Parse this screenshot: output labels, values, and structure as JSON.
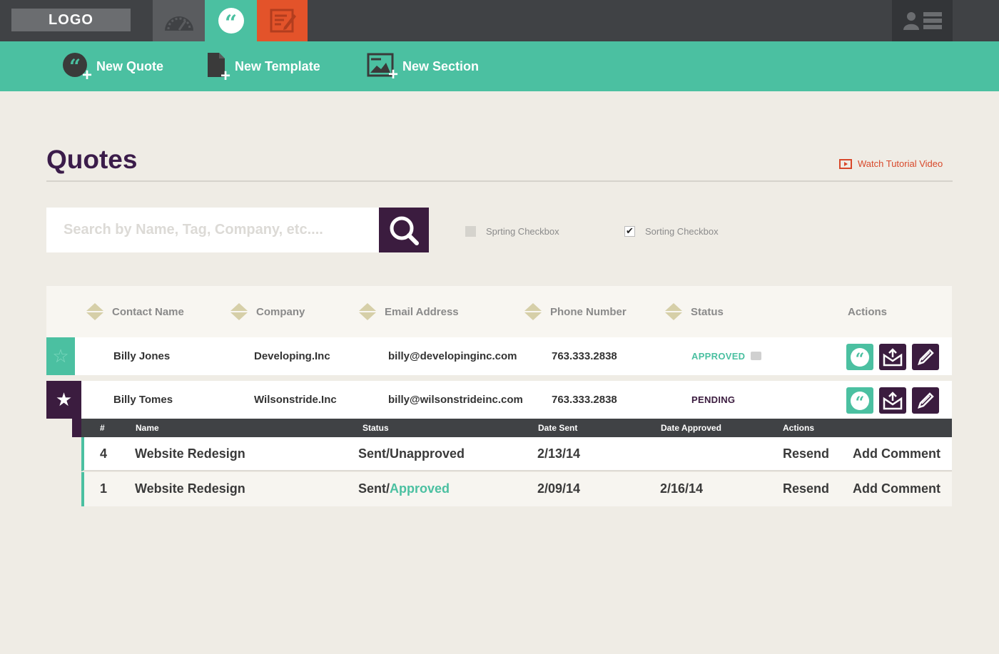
{
  "brand": {
    "logo_text": "LOGO"
  },
  "colors": {
    "teal": "#4bc0a1",
    "purple": "#3b1c3f",
    "orange": "#e3532a",
    "dark": "#404245"
  },
  "nav": {
    "tabs": [
      {
        "icon": "speedometer-icon"
      },
      {
        "icon": "quote-icon",
        "active": true
      },
      {
        "icon": "document-edit-icon"
      }
    ],
    "user_icon": "user-icon",
    "menu_icon": "list-icon"
  },
  "actions": {
    "new_quote": "New Quote",
    "new_template": "New Template",
    "new_section": "New Section"
  },
  "page": {
    "title": "Quotes",
    "tutorial_link": "Watch Tutorial Video"
  },
  "search": {
    "placeholder": "Search by Name, Tag, Company, etc....",
    "value": ""
  },
  "filters": [
    {
      "label": "Sprting Checkbox",
      "checked": false
    },
    {
      "label": "Sorting Checkbox",
      "checked": true
    }
  ],
  "table": {
    "headers": [
      "Contact Name",
      "Company",
      "Email Address",
      "Phone Number",
      "Status",
      "Actions"
    ],
    "rows": [
      {
        "favorite": false,
        "name": "Billy Jones",
        "company": "Developing.Inc",
        "email": "billy@developinginc.com",
        "phone": "763.333.2838",
        "status": "APPROVED"
      },
      {
        "favorite": true,
        "name": "Billy Tomes",
        "company": "Wilsonstride.Inc",
        "email": "billy@wilsonstrideinc.com",
        "phone": "763.333.2838",
        "status": "PENDING"
      }
    ]
  },
  "subtable": {
    "headers": [
      "#",
      "Name",
      "Status",
      "Date Sent",
      "Date Approved",
      "Actions"
    ],
    "rows": [
      {
        "num": "4",
        "name": "Website Redesign",
        "status_prefix": "Sent/",
        "status_suffix": "Unapproved",
        "date_sent": "2/13/14",
        "date_approved": "",
        "resend": "Resend",
        "comment": "Add Comment"
      },
      {
        "num": "1",
        "name": "Website Redesign",
        "status_prefix": "Sent/",
        "status_suffix": "Approved",
        "date_sent": "2/09/14",
        "date_approved": "2/16/14",
        "resend": "Resend",
        "comment": "Add Comment"
      }
    ]
  }
}
